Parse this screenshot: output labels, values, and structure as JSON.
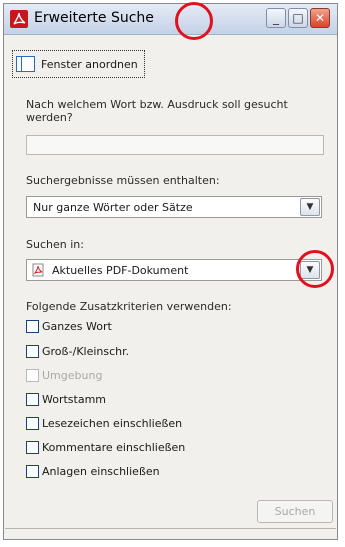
{
  "window": {
    "title": "Erweiterte Suche",
    "minimize": "_",
    "maximize": "□",
    "close": "✕"
  },
  "toolbar": {
    "arrange_label": "Fenster anordnen"
  },
  "search_word": {
    "question": "Nach welchem Wort bzw. Ausdruck soll gesucht werden?",
    "value": ""
  },
  "results_contain": {
    "label": "Suchergebnisse müssen enthalten:",
    "selected": "Nur ganze Wörter oder Sätze"
  },
  "search_in": {
    "label": "Suchen in:",
    "selected": "Aktuelles PDF-Dokument"
  },
  "criteria": {
    "label": "Folgende Zusatzkriterien verwenden:",
    "options": [
      {
        "label": "Ganzes Wort",
        "checked": false,
        "enabled": true
      },
      {
        "label": "Groß-/Kleinschr.",
        "checked": false,
        "enabled": true
      },
      {
        "label": "Umgebung",
        "checked": false,
        "enabled": false
      },
      {
        "label": "Wortstamm",
        "checked": false,
        "enabled": true
      },
      {
        "label": "Lesezeichen einschließen",
        "checked": false,
        "enabled": true
      },
      {
        "label": "Kommentare einschließen",
        "checked": false,
        "enabled": true
      },
      {
        "label": "Anlagen einschließen",
        "checked": false,
        "enabled": true
      }
    ]
  },
  "search_button": "Suchen",
  "colors": {
    "highlight": "#e0101e",
    "titlebar": "#c4d1e6",
    "panel": "#f1f0ec"
  },
  "icons": {
    "app": "acrobat-icon",
    "arrange": "window-arrange-icon",
    "doc": "pdf-document-icon",
    "dropdown": "chevron-down-icon"
  }
}
